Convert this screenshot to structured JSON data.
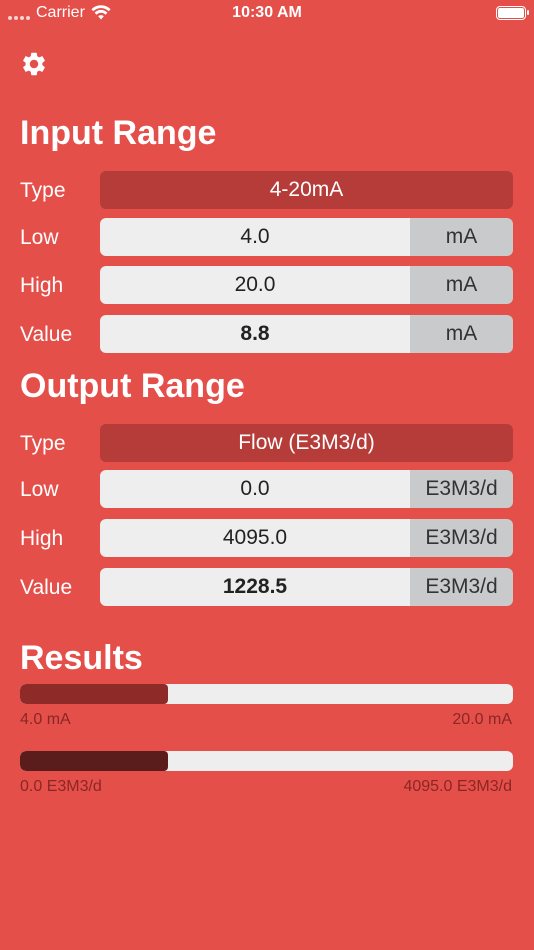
{
  "status_bar": {
    "carrier": "Carrier",
    "time": "10:30 AM",
    "signal_icon": "cellular-dots-icon",
    "wifi_icon": "wifi-icon",
    "battery_icon": "battery-icon"
  },
  "settings_icon": "gear-icon",
  "input_range": {
    "title": "Input Range",
    "type_label": "Type",
    "type_value": "4-20mA",
    "low_label": "Low",
    "low_value": "4.0",
    "low_unit": "mA",
    "high_label": "High",
    "high_value": "20.0",
    "high_unit": "mA",
    "value_label": "Value",
    "value_value": "8.8",
    "value_unit": "mA"
  },
  "output_range": {
    "title": "Output Range",
    "type_label": "Type",
    "type_value": "Flow (E3M3/d)",
    "low_label": "Low",
    "low_value": "0.0",
    "low_unit": "E3M3/d",
    "high_label": "High",
    "high_value": "4095.0",
    "high_unit": "E3M3/d",
    "value_label": "Value",
    "value_value": "1228.5",
    "value_unit": "E3M3/d"
  },
  "results": {
    "title": "Results",
    "input_bar": {
      "fraction": 0.3,
      "min_label": "4.0 mA",
      "max_label": "20.0 mA",
      "color": "#8e2a28"
    },
    "output_bar": {
      "fraction": 0.3,
      "min_label": "0.0 E3M3/d",
      "max_label": "4095.0 E3M3/d",
      "color": "#5a1d1c"
    }
  },
  "colors": {
    "background": "#e44f4a",
    "select_bg": "#b63c39",
    "field_bg": "#eeeeef",
    "unit_bg": "#c8cacb"
  }
}
